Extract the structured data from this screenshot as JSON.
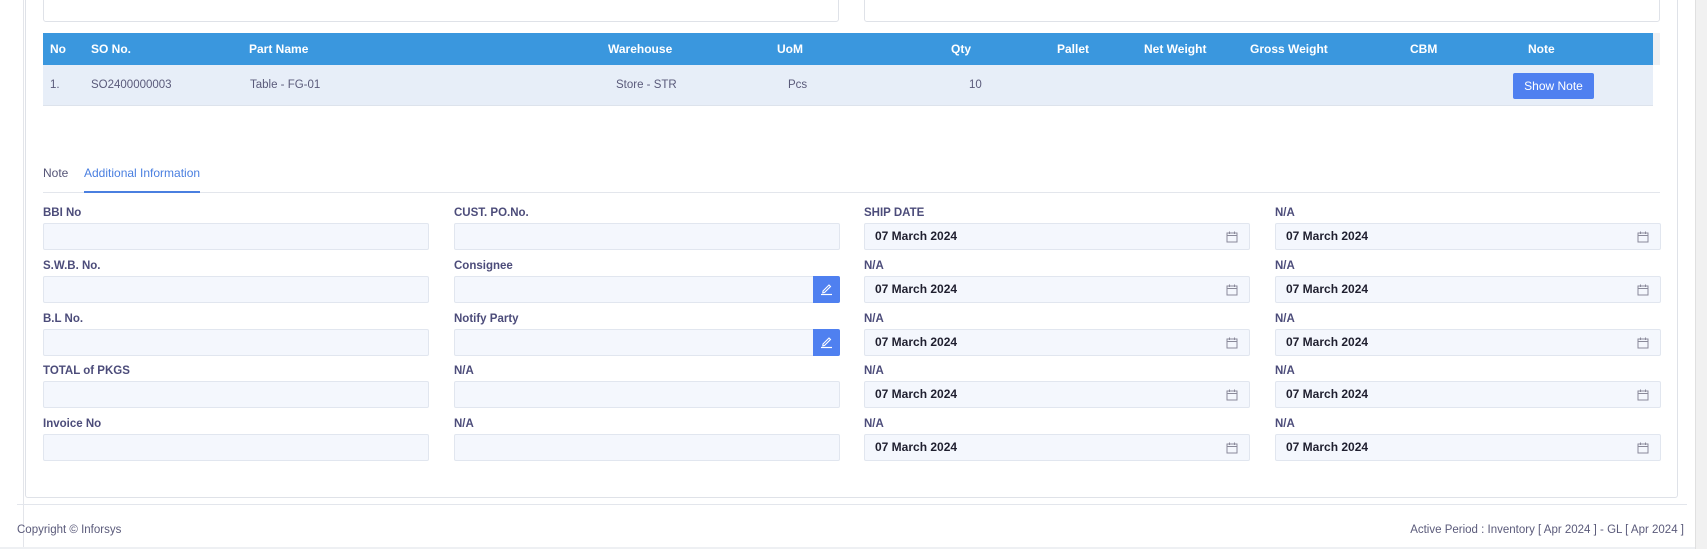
{
  "table": {
    "headers": [
      "No",
      "SO No.",
      "Part Name",
      "Warehouse",
      "UoM",
      "Qty",
      "Pallet",
      "Net Weight",
      "Gross Weight",
      "CBM",
      "Note"
    ],
    "rows": [
      {
        "no": "1.",
        "so_no": "SO2400000003",
        "part_name": "Table - FG-01",
        "warehouse": "Store - STR",
        "uom": "Pcs",
        "qty": "10",
        "pallet": "",
        "net_weight": "",
        "gross_weight": "",
        "cbm": "",
        "note_button": "Show Note"
      }
    ]
  },
  "tabs": [
    {
      "label": "Note",
      "active": false
    },
    {
      "label": "Additional Information",
      "active": true
    }
  ],
  "form": {
    "col1": [
      {
        "label": "BBI No",
        "value": ""
      },
      {
        "label": "S.W.B. No.",
        "value": ""
      },
      {
        "label": "B.L No.",
        "value": ""
      },
      {
        "label": "TOTAL of PKGS",
        "value": ""
      },
      {
        "label": "Invoice No",
        "value": ""
      }
    ],
    "col2": [
      {
        "label": "CUST. PO.No.",
        "value": ""
      },
      {
        "label": "Consignee",
        "value": "",
        "icon": "edit-icon"
      },
      {
        "label": "Notify Party",
        "value": "",
        "icon": "edit-icon"
      },
      {
        "label": "N/A",
        "value": ""
      },
      {
        "label": "N/A",
        "value": ""
      }
    ],
    "col3": [
      {
        "label": "SHIP DATE",
        "value": "07 March 2024",
        "icon": "calendar-icon"
      },
      {
        "label": "N/A",
        "value": "07 March 2024",
        "icon": "calendar-icon"
      },
      {
        "label": "N/A",
        "value": "07 March 2024",
        "icon": "calendar-icon"
      },
      {
        "label": "N/A",
        "value": "07 March 2024",
        "icon": "calendar-icon"
      },
      {
        "label": "N/A",
        "value": "07 March 2024",
        "icon": "calendar-icon"
      }
    ],
    "col4": [
      {
        "label": "N/A",
        "value": "07 March 2024",
        "icon": "calendar-icon"
      },
      {
        "label": "N/A",
        "value": "07 March 2024",
        "icon": "calendar-icon"
      },
      {
        "label": "N/A",
        "value": "07 March 2024",
        "icon": "calendar-icon"
      },
      {
        "label": "N/A",
        "value": "07 March 2024",
        "icon": "calendar-icon"
      },
      {
        "label": "N/A",
        "value": "07 March 2024",
        "icon": "calendar-icon"
      }
    ]
  },
  "footer": {
    "copyright": "Copyright © Inforsys",
    "active_period": "Active Period  :  Inventory [ Apr 2024 ]  -  GL [ Apr 2024 ]"
  },
  "colors": {
    "table_header": "#3a97de",
    "row_bg": "#e7eef8",
    "primary_button": "#4f80f0",
    "tab_active": "#4a7fe0",
    "input_bg": "#f4f7fd"
  }
}
